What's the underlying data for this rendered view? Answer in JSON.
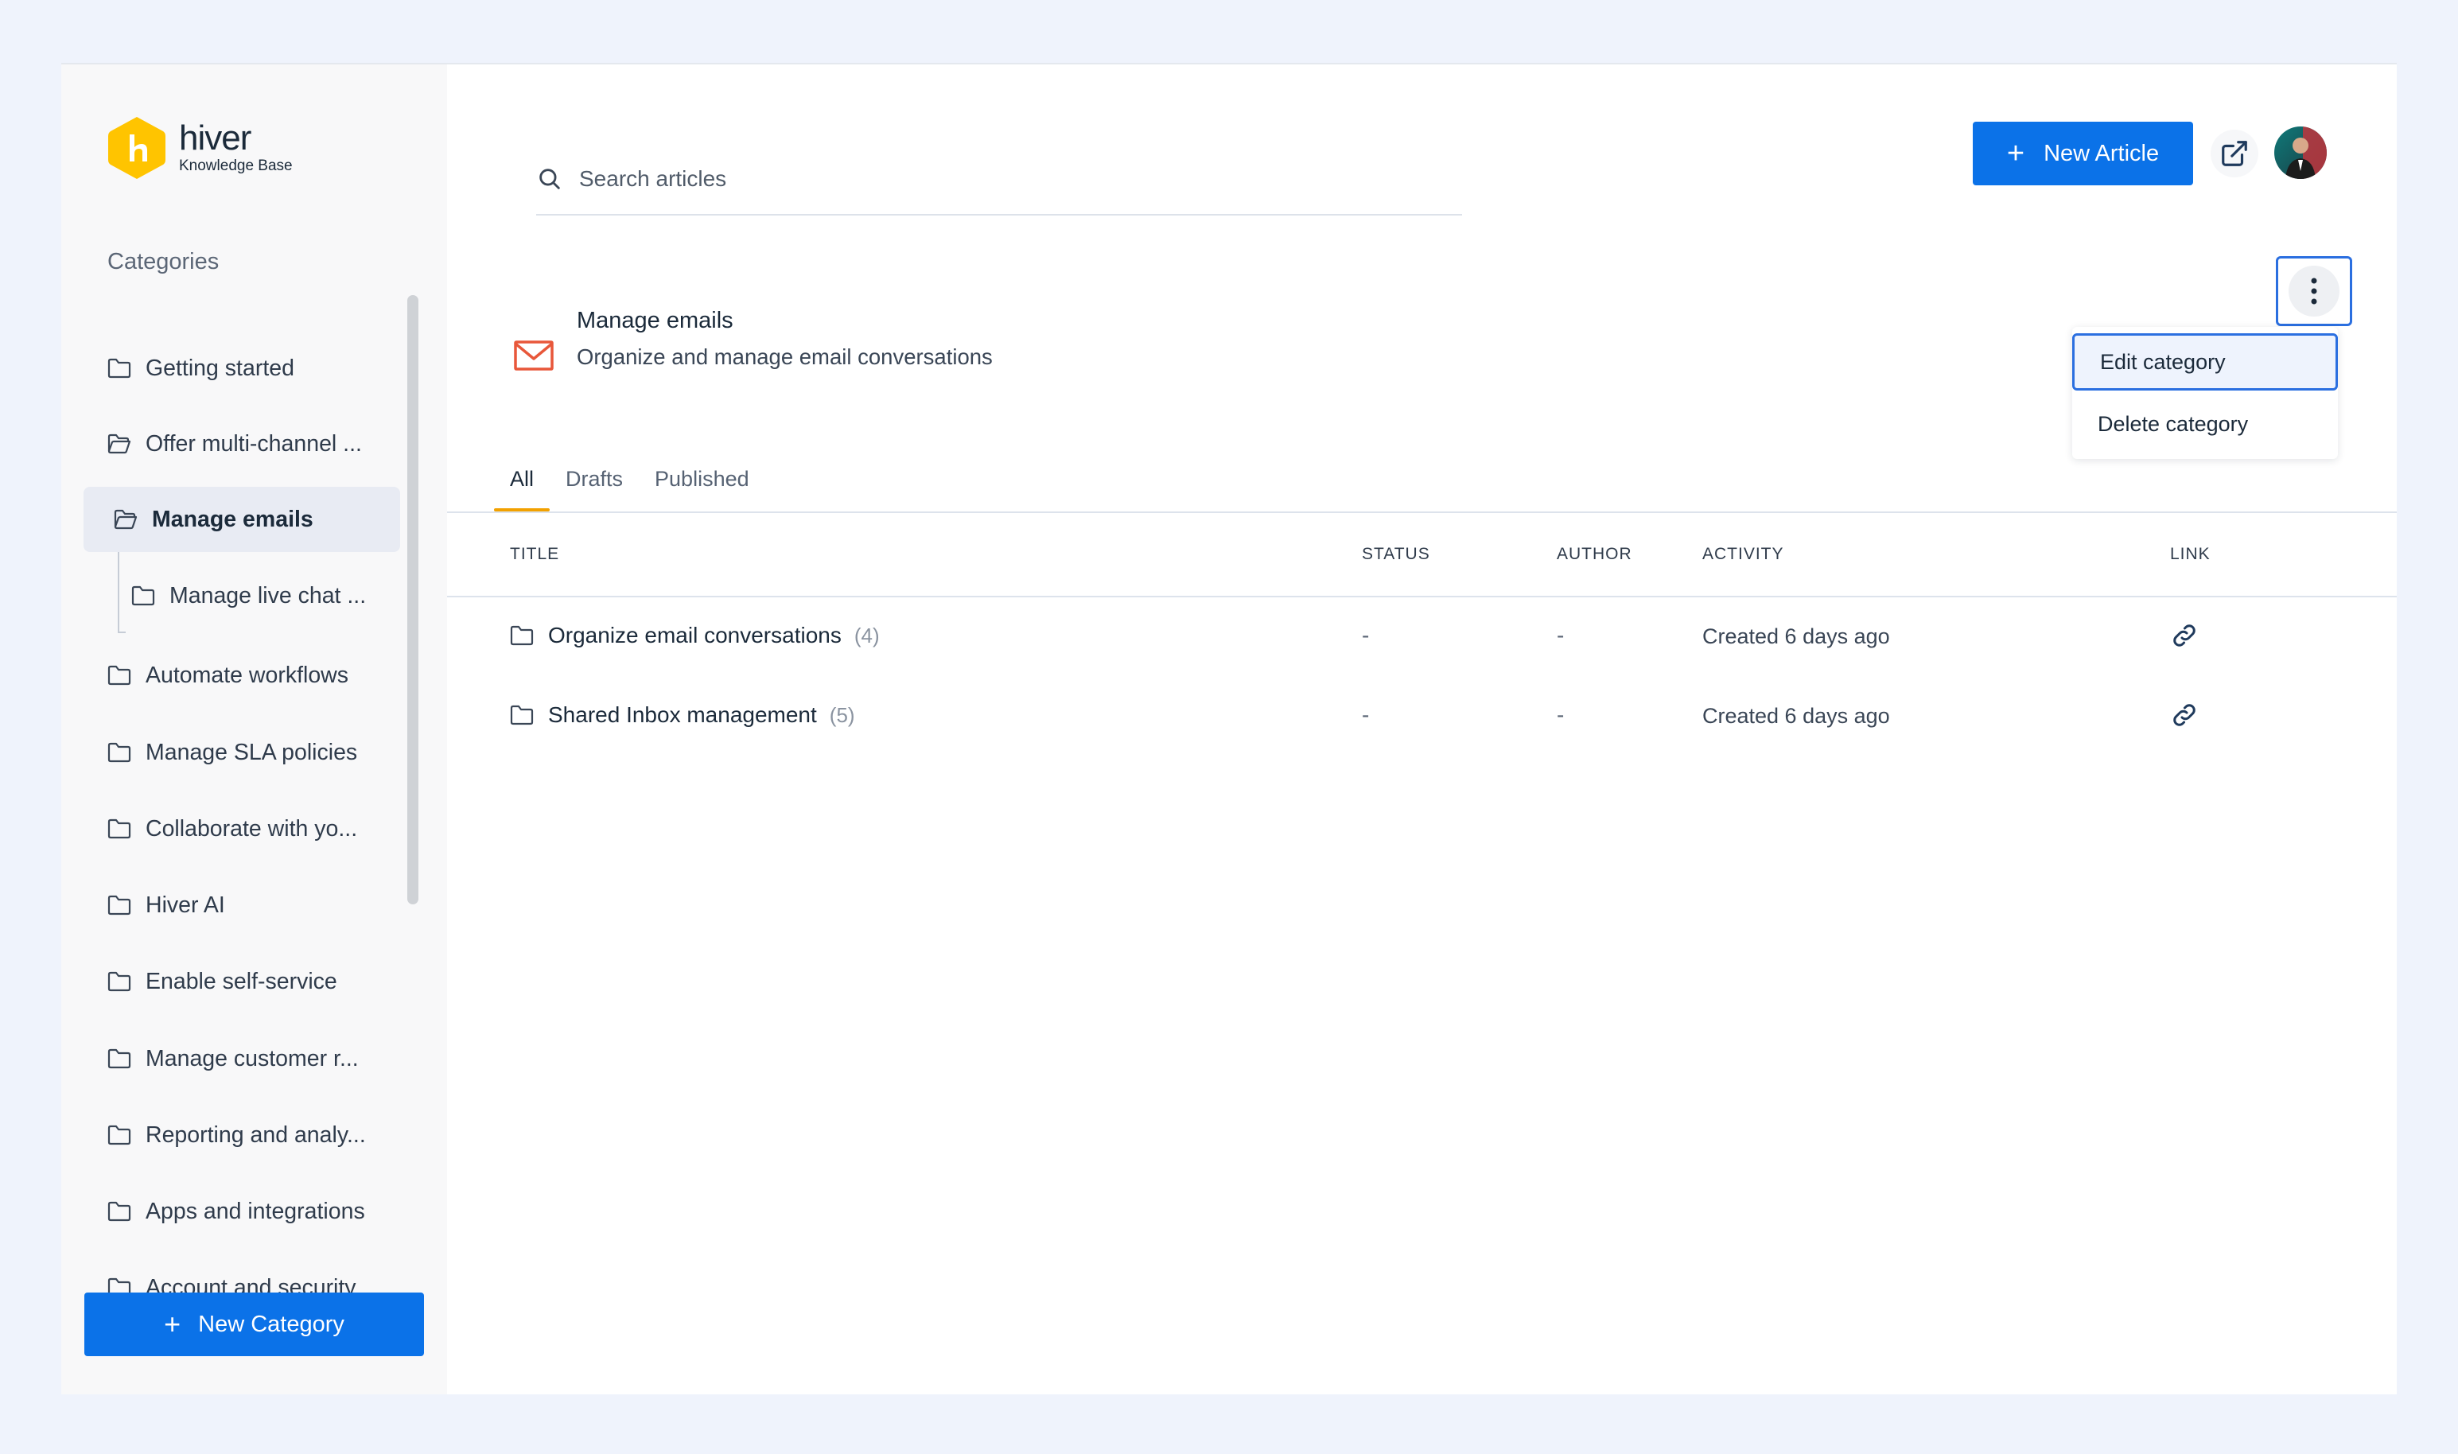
{
  "brand": {
    "name": "hiver",
    "subtitle": "Knowledge Base",
    "logo_color": "#FFC400",
    "accent": "#0B72E8"
  },
  "sidebar": {
    "heading": "Categories",
    "items": [
      {
        "label": "Getting started",
        "icon": "folder-icon"
      },
      {
        "label": "Offer multi-channel ...",
        "icon": "folder-open-icon"
      },
      {
        "label": "Manage emails",
        "icon": "folder-open-icon",
        "active": true
      },
      {
        "label": "Manage live chat ...",
        "icon": "folder-icon"
      },
      {
        "label": "Automate workflows",
        "icon": "folder-icon"
      },
      {
        "label": "Manage SLA policies",
        "icon": "folder-icon"
      },
      {
        "label": "Collaborate with yo...",
        "icon": "folder-icon"
      },
      {
        "label": "Hiver AI",
        "icon": "folder-icon"
      },
      {
        "label": "Enable self-service",
        "icon": "folder-icon"
      },
      {
        "label": "Manage customer r...",
        "icon": "folder-icon"
      },
      {
        "label": "Reporting and analy...",
        "icon": "folder-icon"
      },
      {
        "label": "Apps and integrations",
        "icon": "folder-icon"
      },
      {
        "label": "Account and security",
        "icon": "folder-icon"
      }
    ],
    "new_category_label": "New Category"
  },
  "header": {
    "search_placeholder": "Search articles",
    "new_article_label": "New Article"
  },
  "category": {
    "title": "Manage emails",
    "description": "Organize and manage email conversations",
    "menu": {
      "edit_label": "Edit category",
      "delete_label": "Delete category"
    }
  },
  "tabs": [
    "All",
    "Drafts",
    "Published"
  ],
  "table": {
    "columns": [
      "TITLE",
      "STATUS",
      "AUTHOR",
      "ACTIVITY",
      "LINK"
    ],
    "rows": [
      {
        "title": "Organize email conversations",
        "count": "(4)",
        "status": "-",
        "author": "-",
        "activity": "Created 6 days ago"
      },
      {
        "title": "Shared Inbox management",
        "count": "(5)",
        "status": "-",
        "author": "-",
        "activity": "Created 6 days ago"
      }
    ]
  }
}
